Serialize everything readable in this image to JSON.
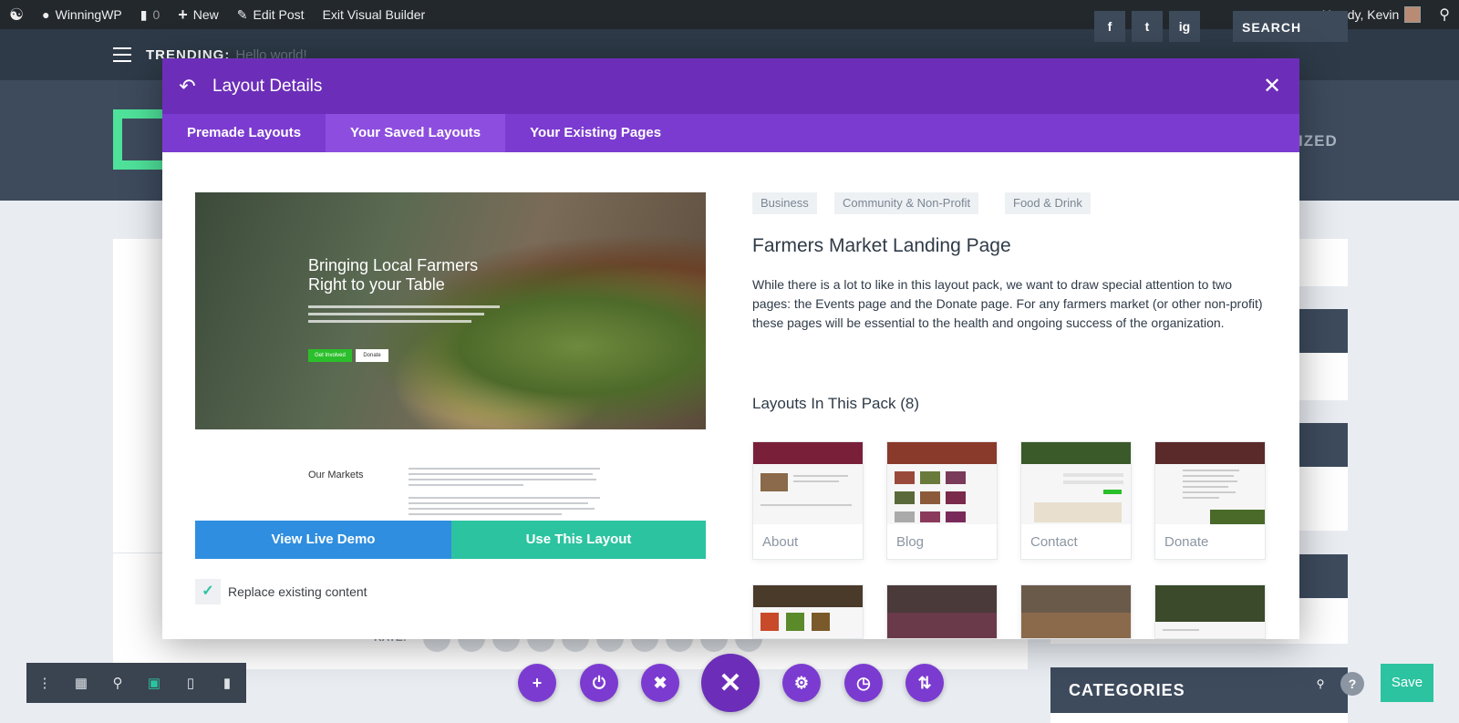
{
  "adminbar": {
    "site_name": "WinningWP",
    "comments": "0",
    "new_label": "New",
    "edit_post": "Edit Post",
    "exit_builder": "Exit Visual Builder",
    "greeting": "Howdy, Kevin"
  },
  "site": {
    "trending_label": "TRENDING:",
    "trending_text": "Hello world!",
    "social": [
      "f",
      "t",
      "ig"
    ],
    "search_label": "SEARCH",
    "nav_fragment": "IZED",
    "rating_label": "RATE:",
    "categories_title": "CATEGORIES"
  },
  "modal": {
    "title": "Layout Details",
    "tabs": [
      "Premade Layouts",
      "Your Saved Layouts",
      "Your Existing Pages"
    ],
    "active_tab": "Your Saved Layouts",
    "preview": {
      "hero_title": "Bringing Local Farmers Right to your Table",
      "hero_button_1": "Get Involved",
      "hero_button_2": "Donate",
      "section_title": "Our Markets"
    },
    "view_demo_label": "View Live Demo",
    "use_layout_label": "Use This Layout",
    "replace_label": "Replace existing content",
    "replace_checked": true,
    "tags": [
      "Business",
      "Community & Non-Profit",
      "Food & Drink"
    ],
    "layout_title": "Farmers Market Landing Page",
    "layout_description": "While there is a lot to like in this layout pack, we want to draw special attention to two pages: the Events page and the Donate page. For any farmers market (or other non-profit) these pages will be essential to the health and ongoing success of the organization.",
    "pack_title": "Layouts In This Pack (8)",
    "pack_layouts": [
      {
        "label": "About",
        "band": "#7a1f3a"
      },
      {
        "label": "Blog",
        "band": "#8a3a2a"
      },
      {
        "label": "Contact",
        "band": "#3a5a2a"
      },
      {
        "label": "Donate",
        "band": "#5a2a2a"
      },
      {
        "label": "",
        "band": "#4a3a2a"
      },
      {
        "label": "",
        "band": "#3a2a2a"
      },
      {
        "label": "",
        "band": "#5a4a3a"
      },
      {
        "label": "",
        "band": "#3a4a2a"
      }
    ]
  },
  "toolbar": {
    "save_label": "Save"
  },
  "colors": {
    "purple_dark": "#6c2eb9",
    "purple": "#7b3bd0",
    "blue": "#2f8ee0",
    "teal": "#2cc3a0"
  }
}
